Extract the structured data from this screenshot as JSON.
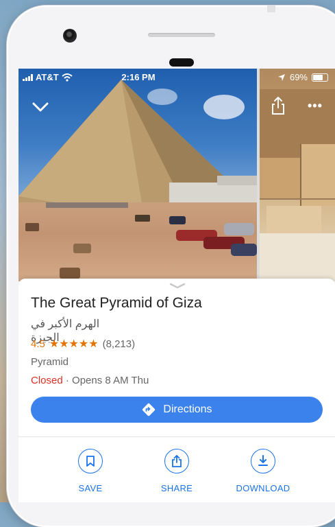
{
  "status_bar": {
    "carrier": "AT&T",
    "time": "2:16 PM",
    "battery": "69%"
  },
  "place": {
    "name": "The Great Pyramid of Giza",
    "name_arabic": "الهرم الأكبر في الجيزة",
    "rating": "4.5",
    "stars": "★★★★★",
    "review_count": "(8,213)",
    "category": "Pyramid",
    "status": "Closed",
    "opens": "· Opens 8 AM Thu"
  },
  "buttons": {
    "directions": "Directions",
    "save": "SAVE",
    "share": "SHARE",
    "download": "DOWNLOAD"
  },
  "colors": {
    "accent": "#1a73e8",
    "directions_bg": "#3b82ed",
    "rating": "#e37400",
    "closed": "#d93025"
  }
}
